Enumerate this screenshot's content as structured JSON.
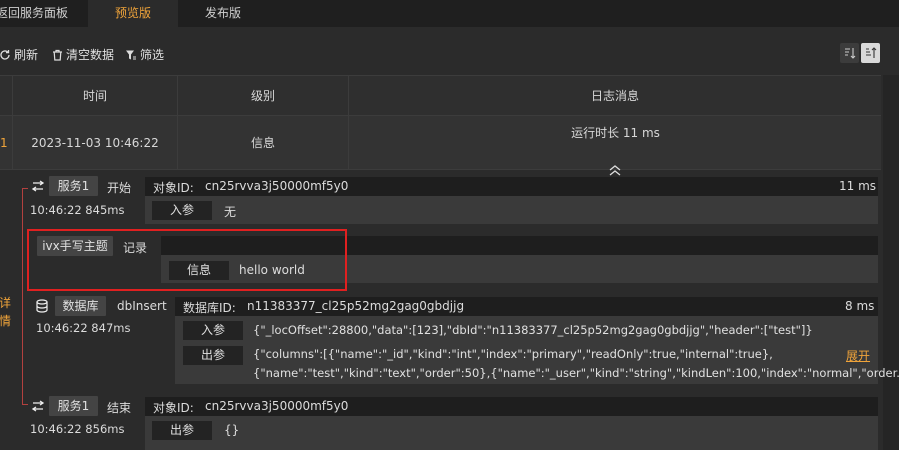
{
  "tabs": [
    {
      "label": "返回服务面板"
    },
    {
      "label": "预览版"
    },
    {
      "label": "发布版"
    }
  ],
  "toolbar": {
    "refresh": "刷新",
    "clear": "清空数据",
    "filter": "筛选"
  },
  "table": {
    "headers": [
      "时间",
      "级别",
      "日志消息"
    ],
    "row": {
      "index": "1",
      "time": "2023-11-03 10:46:22",
      "level": "信息",
      "message": "运行时长 11 ms"
    }
  },
  "detail": {
    "label_line1": "详",
    "label_line2": "情",
    "service_start": {
      "tag": "服务1",
      "action": "开始",
      "object_id_label": "对象ID:",
      "object_id": "cn25rvva3j50000mf5y0",
      "duration": "11 ms",
      "time": "10:46:22 845ms",
      "param_button": "入参",
      "param_value": "无"
    },
    "log": {
      "tag": "ivx手写主题",
      "action": "记录",
      "level_button": "信息",
      "message": "hello world"
    },
    "database": {
      "tag": "数据库",
      "action": "dbInsert",
      "db_id_label": "数据库ID:",
      "db_id": "n11383377_cl25p52mg2gag0gbdjjg",
      "duration": "8 ms",
      "time": "10:46:22 847ms",
      "input_button": "入参",
      "input_value": "{\"_locOffset\":28800,\"data\":[123],\"dbId\":\"n11383377_cl25p52mg2gag0gbdjjg\",\"header\":[\"test\"]}",
      "output_button": "出参",
      "output_line1": "{\"columns\":[{\"name\":\"_id\",\"kind\":\"int\",\"index\":\"primary\",\"readOnly\":true,\"internal\":true},",
      "output_line2": "{\"name\":\"test\",\"kind\":\"text\",\"order\":50},{\"name\":\"_user\",\"kind\":\"string\",\"kindLen\":100,\"index\":\"normal\",\"order...",
      "expand": "展开"
    },
    "service_end": {
      "tag": "服务1",
      "action": "结束",
      "object_id_label": "对象ID:",
      "object_id": "cn25rvva3j50000mf5y0",
      "time": "10:46:22 856ms",
      "output_button": "出参",
      "output_value": "{}"
    }
  },
  "colors": {
    "accent": "#f0a43a",
    "highlight_box": "#e02020",
    "connector": "#b3413f"
  }
}
